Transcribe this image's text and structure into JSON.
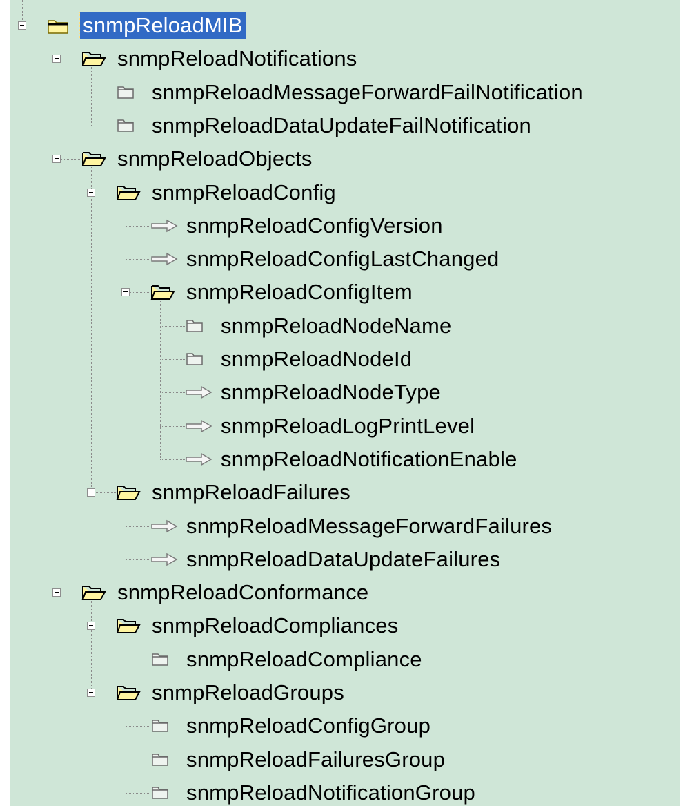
{
  "tree": {
    "nodes": [
      {
        "label": "snmpReloadMIB",
        "icon": "folder-closed-icon",
        "level": 0,
        "expander": true,
        "selected": true
      },
      {
        "label": "snmpReloadNotifications",
        "icon": "folder-open-icon",
        "level": 1,
        "expander": true
      },
      {
        "label": "snmpReloadMessageForwardFailNotification",
        "icon": "notification-icon",
        "level": 2,
        "expander": false
      },
      {
        "label": "snmpReloadDataUpdateFailNotification",
        "icon": "notification-icon",
        "level": 2,
        "expander": false
      },
      {
        "label": "snmpReloadObjects",
        "icon": "folder-open-icon",
        "level": 1,
        "expander": true
      },
      {
        "label": "snmpReloadConfig",
        "icon": "folder-open-icon",
        "level": 2,
        "expander": true
      },
      {
        "label": "snmpReloadConfigVersion",
        "icon": "scalar-arrow-icon",
        "level": 3,
        "expander": false
      },
      {
        "label": "snmpReloadConfigLastChanged",
        "icon": "scalar-arrow-icon",
        "level": 3,
        "expander": false
      },
      {
        "label": "snmpReloadConfigItem",
        "icon": "folder-open-icon",
        "level": 3,
        "expander": true
      },
      {
        "label": "snmpReloadNodeName",
        "icon": "notification-icon",
        "level": 4,
        "expander": false
      },
      {
        "label": "snmpReloadNodeId",
        "icon": "notification-icon",
        "level": 4,
        "expander": false
      },
      {
        "label": "snmpReloadNodeType",
        "icon": "scalar-arrow-icon",
        "level": 4,
        "expander": false
      },
      {
        "label": "snmpReloadLogPrintLevel",
        "icon": "scalar-arrow-icon",
        "level": 4,
        "expander": false
      },
      {
        "label": "snmpReloadNotificationEnable",
        "icon": "scalar-arrow-icon",
        "level": 4,
        "expander": false
      },
      {
        "label": "snmpReloadFailures",
        "icon": "folder-open-icon",
        "level": 2,
        "expander": true
      },
      {
        "label": "snmpReloadMessageForwardFailures",
        "icon": "scalar-arrow-icon",
        "level": 3,
        "expander": false
      },
      {
        "label": "snmpReloadDataUpdateFailures",
        "icon": "scalar-arrow-icon",
        "level": 3,
        "expander": false
      },
      {
        "label": "snmpReloadConformance",
        "icon": "folder-open-icon",
        "level": 1,
        "expander": true
      },
      {
        "label": "snmpReloadCompliances",
        "icon": "folder-open-icon",
        "level": 2,
        "expander": true
      },
      {
        "label": "snmpReloadCompliance",
        "icon": "notification-icon",
        "level": 3,
        "expander": false
      },
      {
        "label": "snmpReloadGroups",
        "icon": "folder-open-icon",
        "level": 2,
        "expander": true
      },
      {
        "label": "snmpReloadConfigGroup",
        "icon": "notification-icon",
        "level": 3,
        "expander": false
      },
      {
        "label": "snmpReloadFailuresGroup",
        "icon": "notification-icon",
        "level": 3,
        "expander": false
      },
      {
        "label": "snmpReloadNotificationGroup",
        "icon": "notification-icon",
        "level": 3,
        "expander": false
      }
    ]
  },
  "colors": {
    "background": "#cfe6d7",
    "selection": "#316ac5",
    "folder_fill": "#fff5a0",
    "folder_stroke": "#7a6a00"
  }
}
